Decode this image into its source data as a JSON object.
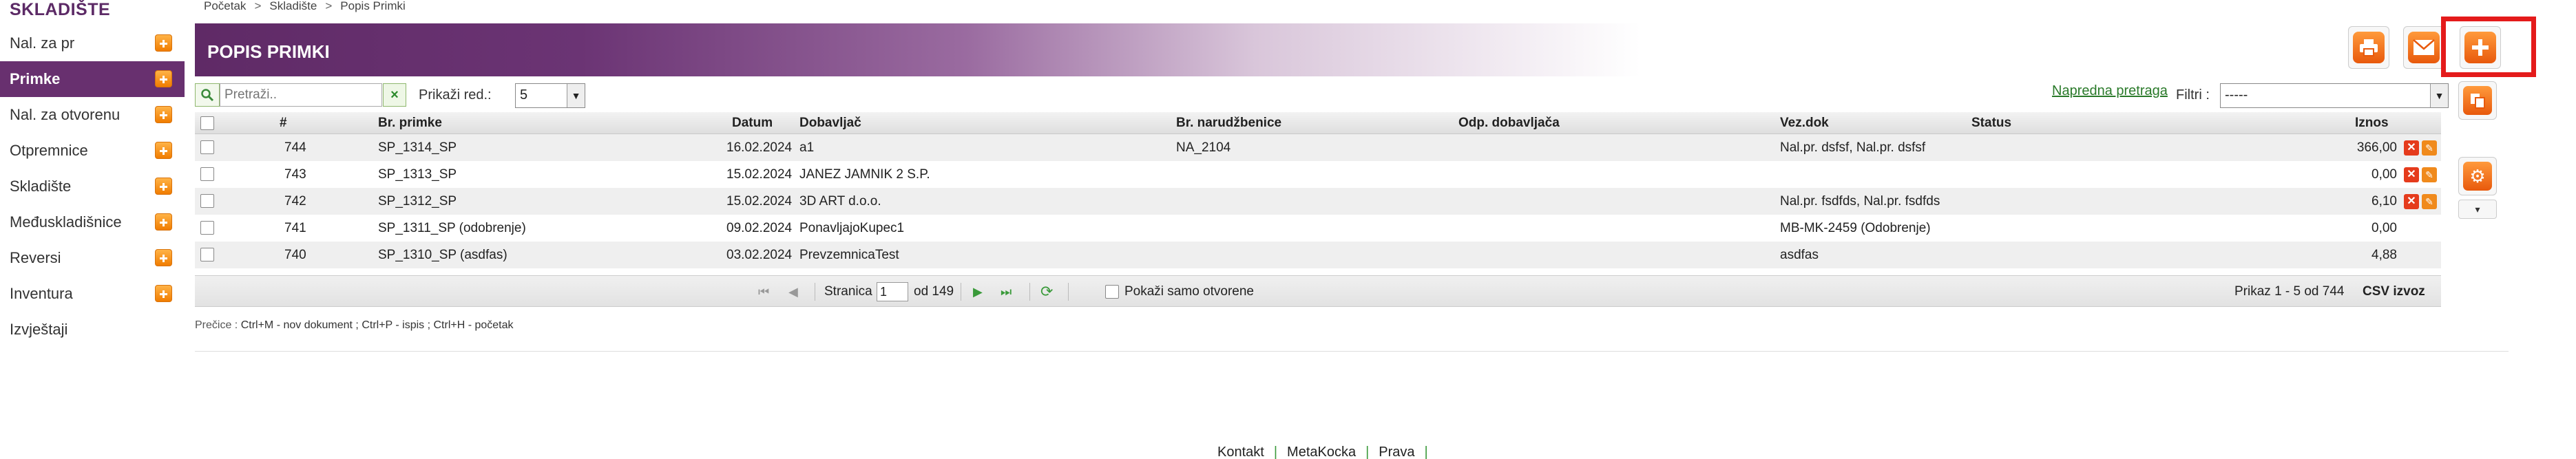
{
  "breadcrumb": [
    "Početak",
    "Skladište",
    "Popis Primki"
  ],
  "sidebar": {
    "title": "SKLADIŠTE",
    "items": [
      {
        "label": "Nal. za pr",
        "plus": true
      },
      {
        "label": "Primke",
        "plus": true,
        "active": true
      },
      {
        "label": "Nal. za otvorenu",
        "plus": true
      },
      {
        "label": "Otpremnice",
        "plus": true
      },
      {
        "label": "Skladište",
        "plus": true
      },
      {
        "label": "Međuskladišnice",
        "plus": true
      },
      {
        "label": "Reversi",
        "plus": true
      },
      {
        "label": "Inventura",
        "plus": true
      },
      {
        "label": "Izvještaji",
        "plus": false
      }
    ]
  },
  "header": {
    "title": "POPIS PRIMKI",
    "buttons": [
      "print-icon",
      "mail-icon",
      "plus-icon"
    ]
  },
  "side_buttons": [
    "copy-icon",
    "gear-icon"
  ],
  "toolbar": {
    "search_placeholder": "Pretraži..",
    "rows_label": "Prikaži red.:",
    "rows_value": "5",
    "advanced_search": "Napredna pretraga",
    "filter_label": "Filtri :",
    "filter_value": "-----"
  },
  "table": {
    "columns": [
      "#",
      "Br. primke",
      "Datum",
      "Dobavljač",
      "Br. narudžbenice",
      "Odp. dobavljača",
      "Vez.dok",
      "Status",
      "Iznos"
    ],
    "rows": [
      {
        "num": "744",
        "br_primke": "SP_1314_SP",
        "datum": "16.02.2024",
        "dobavljac": "a1",
        "br_narudzbenice": "NA_2104",
        "odp": "",
        "vez_dok": "Nal.pr. dsfsf, Nal.pr. dsfsf",
        "status": "",
        "iznos": "366,00",
        "actions": true
      },
      {
        "num": "743",
        "br_primke": "SP_1313_SP",
        "datum": "15.02.2024",
        "dobavljac": "JANEZ JAMNIK 2 S.P.",
        "br_narudzbenice": "",
        "odp": "",
        "vez_dok": "",
        "status": "",
        "iznos": "0,00",
        "actions": true
      },
      {
        "num": "742",
        "br_primke": "SP_1312_SP",
        "datum": "15.02.2024",
        "dobavljac": "3D ART d.o.o.",
        "br_narudzbenice": "",
        "odp": "",
        "vez_dok": "Nal.pr. fsdfds, Nal.pr. fsdfds",
        "status": "",
        "iznos": "6,10",
        "actions": true
      },
      {
        "num": "741",
        "br_primke": "SP_1311_SP (odobrenje)",
        "datum": "09.02.2024",
        "dobavljac": "PonavljajoKupec1",
        "br_narudzbenice": "",
        "odp": "",
        "vez_dok": "MB-MK-2459 (Odobrenje)",
        "status": "",
        "iznos": "0,00",
        "actions": false
      },
      {
        "num": "740",
        "br_primke": "SP_1310_SP (asdfas)",
        "datum": "03.02.2024",
        "dobavljac": "PrevzemnicaTest",
        "br_narudzbenice": "",
        "odp": "",
        "vez_dok": "asdfas",
        "status": "",
        "iznos": "4,88",
        "actions": false
      }
    ]
  },
  "pager": {
    "page_label": "Stranica",
    "page_value": "1",
    "of_label": "od 149",
    "show_open_label": "Pokaži samo otvorene",
    "summary": "Prikaz 1 - 5 od 744",
    "csv": "CSV izvoz"
  },
  "shortcuts": {
    "prefix": "Prečice :",
    "text": " Ctrl+M - nov dokument ;   Ctrl+P - ispis ;   Ctrl+H - početak"
  },
  "footer": [
    "Kontakt",
    "MetaKocka",
    "Prava"
  ],
  "colors": {
    "brand": "#68306f",
    "accent": "#f07c00",
    "highlight": "#e41b1b",
    "link": "#2a7a2a"
  }
}
